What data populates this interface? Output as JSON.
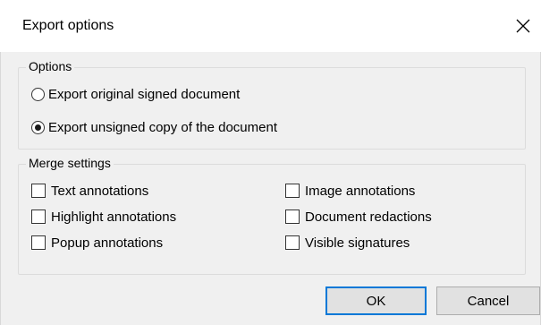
{
  "dialog": {
    "title": "Export options",
    "close_icon": "close-icon"
  },
  "options": {
    "legend": "Options",
    "radios": [
      {
        "label": "Export original signed document",
        "checked": false
      },
      {
        "label": "Export unsigned copy of the document",
        "checked": true
      }
    ]
  },
  "merge": {
    "legend": "Merge settings",
    "checkboxes": [
      {
        "label": "Text annotations",
        "checked": false
      },
      {
        "label": "Highlight annotations",
        "checked": false
      },
      {
        "label": "Popup annotations",
        "checked": false
      },
      {
        "label": "Image annotations",
        "checked": false
      },
      {
        "label": "Document redactions",
        "checked": false
      },
      {
        "label": "Visible signatures",
        "checked": false
      }
    ]
  },
  "buttons": {
    "ok": "OK",
    "cancel": "Cancel"
  },
  "colors": {
    "accent": "#0078d7",
    "background": "#f0f0f0"
  }
}
